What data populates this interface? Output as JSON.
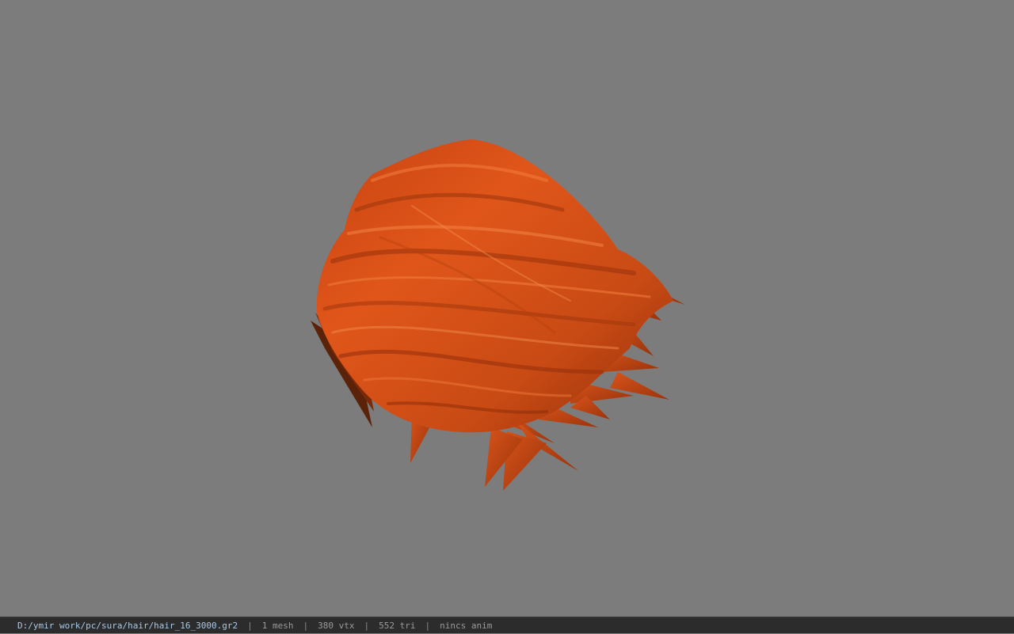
{
  "viewer": {
    "background_color": "#7c7c7c",
    "model_icon": "hair-mesh",
    "hair_color": "#e0561a"
  },
  "status": {
    "file_path": "D:/ymir work/pc/sura/hair/hair_16_3000.gr2",
    "separator": "|",
    "mesh_count": "1 mesh",
    "vertex_count": "380 vtx",
    "triangle_count": "552 tri",
    "anim": "nincs anim"
  }
}
